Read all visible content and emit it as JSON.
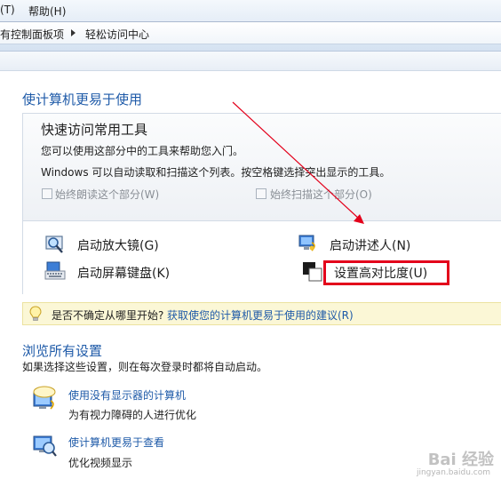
{
  "address": {
    "crumb1": "有控制面板项",
    "crumb2": "轻松访问中心"
  },
  "menu": {
    "item1": "(T)",
    "item2": "帮助(H)"
  },
  "main": {
    "heading": "使计算机更易于使用",
    "quick": {
      "title": "快速访问常用工具",
      "line1": "您可以使用这部分中的工具来帮助您入门。",
      "line2": "Windows 可以自动读取和扫描这个列表。按空格键选择突出显示的工具。",
      "check_read": "始终朗读这个部分(W)",
      "check_scan": "始终扫描这个部分(O)"
    },
    "tools": {
      "magnifier": "启动放大镜(G)",
      "narrator": "启动讲述人(N)",
      "osk": "启动屏幕键盘(K)",
      "contrast": "设置高对比度(U)"
    },
    "tip": {
      "text": "是否不确定从哪里开始?",
      "link": "获取使您的计算机更易于使用的建议(R)"
    }
  },
  "browse": {
    "heading": "浏览所有设置",
    "desc": "如果选择这些设置，则在每次登录时都将自动启动。",
    "items": [
      {
        "link": "使用没有显示器的计算机",
        "desc": "为有视力障碍的人进行优化"
      },
      {
        "link": "使计算机更易于查看",
        "desc": "优化视频显示"
      }
    ]
  },
  "colors": {
    "link": "#1e5aa8",
    "highlight": "#e3001b",
    "annotation_arrow": "#e3001b"
  },
  "watermark": {
    "brand": "Bai 经验",
    "url": "jingyan.baidu.com"
  }
}
